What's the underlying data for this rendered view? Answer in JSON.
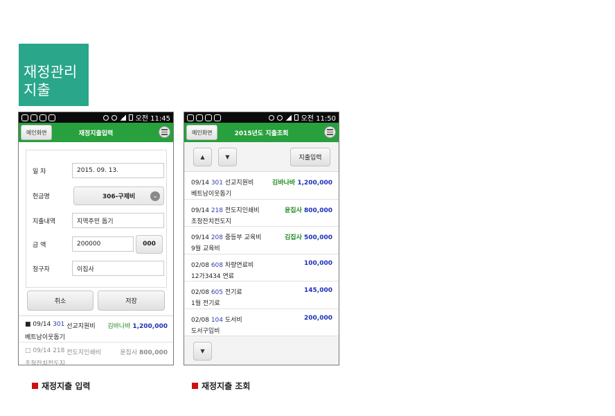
{
  "title": {
    "line1": "재정관리",
    "line2": "지출"
  },
  "status_bar": {
    "left": {
      "time": "오전 11:45"
    },
    "right": {
      "time": "오전 11:50"
    }
  },
  "left_screen": {
    "menu_label": "메인화면",
    "title": "재정지출입력",
    "form": {
      "date_label": "일 자",
      "date_value": "2015. 09. 13.",
      "account_label": "헌금명",
      "account_value": "306-구제비",
      "desc_label": "지출내역",
      "desc_value": "지역주민 돕기",
      "amount_label": "금 액",
      "amount_value": "200000",
      "amount_button": "000",
      "requester_label": "청구자",
      "requester_value": "이집사"
    },
    "cancel_label": "취소",
    "save_label": "저장",
    "recent": [
      {
        "bullet": "■",
        "date": "09/14",
        "code": "301",
        "name": "선교지원비",
        "who": "김바나바",
        "amount": "1,200,000",
        "memo": "베트남이웃돕기"
      },
      {
        "bullet": "□",
        "date": "09/14",
        "code": "218",
        "name": "전도지인쇄비",
        "who": "윤집사",
        "amount": "800,000",
        "memo": "초청잔치전도지"
      }
    ]
  },
  "right_screen": {
    "menu_label": "메인화면",
    "title": "2015년도 지출조회",
    "up_label": "▲",
    "down_label": "▼",
    "input_label": "지출입력",
    "items": [
      {
        "date": "09/14",
        "code": "301",
        "name": "선교지원비",
        "who": "김바나바",
        "amount": "1,200,000",
        "memo": "베트남이웃돕기"
      },
      {
        "date": "09/14",
        "code": "218",
        "name": "전도지인쇄비",
        "who": "윤집사",
        "amount": "800,000",
        "memo": "초청잔치전도지"
      },
      {
        "date": "09/14",
        "code": "208",
        "name": "중등부 교육비",
        "who": "김집사",
        "amount": "500,000",
        "memo": "9월 교육비"
      },
      {
        "date": "02/08",
        "code": "608",
        "name": "차량연료비",
        "who": "",
        "amount": "100,000",
        "memo": "12가3434 연료"
      },
      {
        "date": "02/08",
        "code": "605",
        "name": "전기료",
        "who": "",
        "amount": "145,000",
        "memo": "1월 전기료"
      },
      {
        "date": "02/08",
        "code": "104",
        "name": "도서비",
        "who": "",
        "amount": "200,000",
        "memo": "도서구입비"
      }
    ],
    "bottom_down_label": "▼"
  },
  "captions": {
    "left": "재정지출 입력",
    "right": "재정지출 조회"
  },
  "colors": {
    "title_tile": "#2aa68a",
    "app_bar": "#27a03d",
    "amount": "#1c2fb7",
    "who": "#1f8a1f",
    "caption_marker": "#cc1111"
  }
}
